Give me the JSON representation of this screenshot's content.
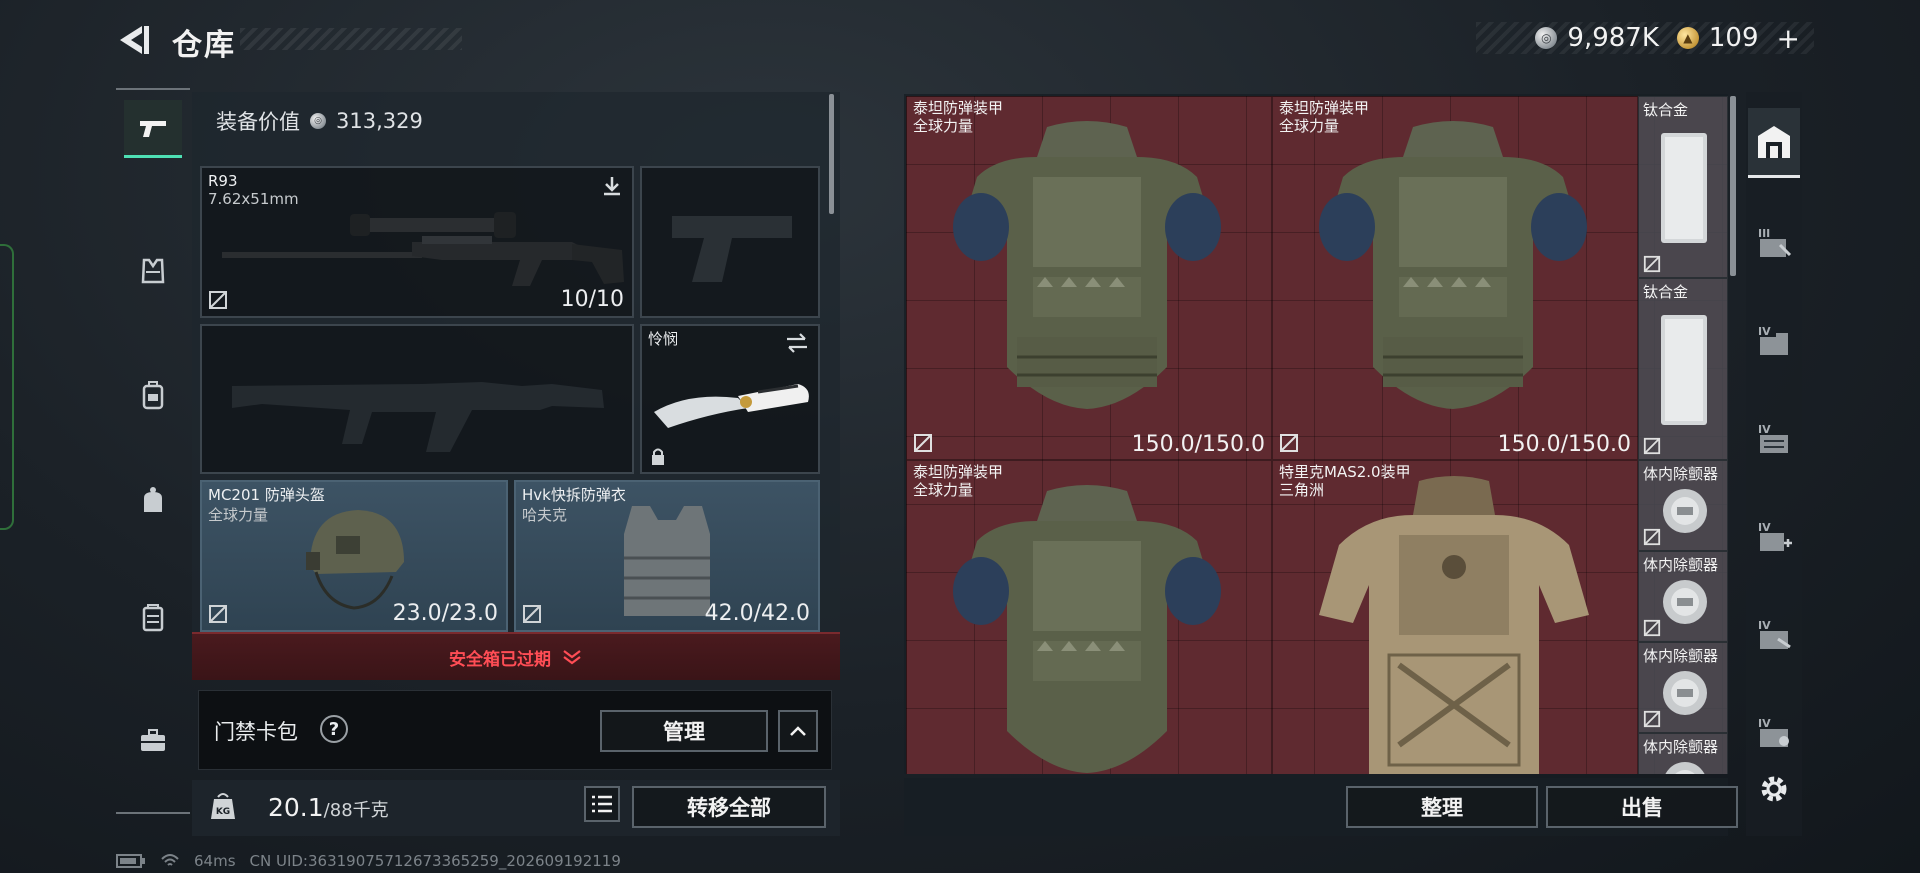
{
  "header": {
    "title": "仓库"
  },
  "currency": {
    "silver": "9,987K",
    "gold": "109",
    "add_label": "+"
  },
  "equipment": {
    "value_label": "装备价值",
    "value": "313,329",
    "primary": {
      "name": "R93",
      "caliber": "7.62x51mm",
      "ammo": "10/10"
    },
    "melee": {
      "name": "怜悯"
    },
    "helmet": {
      "name": "MC201 防弹头盔",
      "brand": "全球力量",
      "durability": "23.0/23.0"
    },
    "armor": {
      "name": "Hvk快拆防弹衣",
      "brand": "哈夫克",
      "durability": "42.0/42.0"
    },
    "safebox_warning": "安全箱已过期",
    "keycard_label": "门禁卡包",
    "help_label": "?",
    "manage_label": "管理",
    "weight": {
      "current": "20.1",
      "max": "/88千克"
    },
    "transfer_all_label": "转移全部"
  },
  "stash": {
    "items": [
      {
        "name": "泰坦防弹装甲",
        "brand": "全球力量",
        "durability": "150.0/150.0"
      },
      {
        "name": "泰坦防弹装甲",
        "brand": "全球力量",
        "durability": "150.0/150.0"
      },
      {
        "name": "泰坦防弹装甲",
        "brand": "全球力量",
        "durability": ""
      },
      {
        "name": "特里克MAS2.0装甲",
        "brand": "三角洲",
        "durability": ""
      }
    ],
    "small_items": [
      {
        "name": "钛合金"
      },
      {
        "name": "钛合金"
      },
      {
        "name": "体内除颤器"
      },
      {
        "name": "体内除颤器"
      },
      {
        "name": "体内除颤器"
      },
      {
        "name": "体内除颤器"
      }
    ],
    "sort_label": "整理",
    "sell_label": "出售"
  },
  "status": {
    "ping": "64ms",
    "uid": "CN UID:3631907571267336525​9_202609192119"
  },
  "colors": {
    "accent": "#4ee0b4",
    "warning": "#ff4d55",
    "stash_bg": "#5f2a30"
  }
}
